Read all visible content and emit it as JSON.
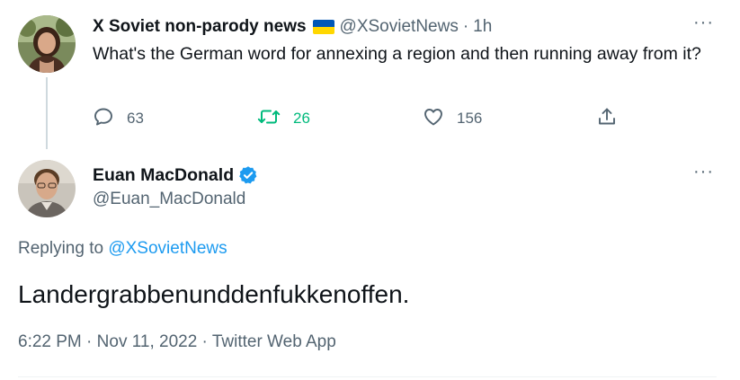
{
  "parent_tweet": {
    "author_name": "X Soviet non-parody news",
    "handle": "@XSovietNews",
    "separator": "·",
    "time": "1h",
    "text": "What's the German word for annexing a region and then running away from it?",
    "more_label": "···",
    "actions": {
      "replies": "63",
      "retweets": "26",
      "likes": "156"
    },
    "flag_colors": [
      "#0057b7",
      "#ffd700"
    ]
  },
  "main_tweet": {
    "author_name": "Euan MacDonald",
    "handle": "@Euan_MacDonald",
    "more_label": "···",
    "replying_prefix": "Replying to",
    "replying_to": "@XSovietNews",
    "text": "Landergrabbenunddenfukkenoffen.",
    "time": "6:22 PM",
    "separator": " · ",
    "date": "Nov 11, 2022",
    "source": "Twitter Web App"
  },
  "icons": {
    "reply": "reply-icon",
    "retweet": "retweet-icon",
    "like": "like-icon",
    "share": "share-icon",
    "verified": "verified-badge-icon"
  },
  "colors": {
    "text": "#0f1419",
    "muted": "#536471",
    "link": "#1d9bf0",
    "retweet_green": "#00ba7c",
    "thread_line": "#cfd9de"
  }
}
